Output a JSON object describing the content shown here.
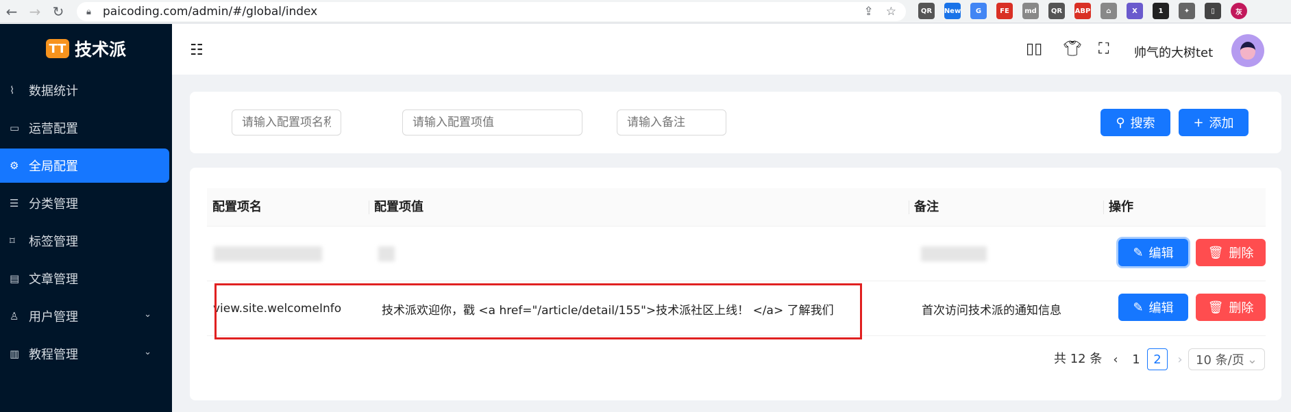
{
  "browser": {
    "url": "paicoding.com/admin/#/global/index",
    "extensions": [
      {
        "label": "QR",
        "color": "#555555"
      },
      {
        "label": "New",
        "color": "#1a73e8"
      },
      {
        "label": "G",
        "color": "#4285f4"
      },
      {
        "label": "FE",
        "color": "#d93025"
      },
      {
        "label": "md",
        "color": "#888888"
      },
      {
        "label": "QR",
        "color": "#555555"
      },
      {
        "label": "ABP",
        "color": "#d93025"
      },
      {
        "label": "⌂",
        "color": "#888888"
      },
      {
        "label": "X",
        "color": "#6a5acd"
      },
      {
        "label": "1",
        "color": "#222222"
      },
      {
        "label": "✦",
        "color": "#666666"
      },
      {
        "label": "▯",
        "color": "#444444"
      },
      {
        "label": "灰",
        "color": "#c2185b"
      }
    ]
  },
  "sidebar": {
    "logo_mark": "TT",
    "logo_text": "技术派",
    "items": [
      {
        "label": "数据统计",
        "icon": "chart-line-icon",
        "glyph": "⌇"
      },
      {
        "label": "运营配置",
        "icon": "calendar-icon",
        "glyph": "▭"
      },
      {
        "label": "全局配置",
        "icon": "gear-icon",
        "glyph": "⚙"
      },
      {
        "label": "分类管理",
        "icon": "list-icon",
        "glyph": "☰"
      },
      {
        "label": "标签管理",
        "icon": "tag-icon",
        "glyph": "⌑"
      },
      {
        "label": "文章管理",
        "icon": "document-icon",
        "glyph": "▤"
      },
      {
        "label": "用户管理",
        "icon": "user-icon",
        "glyph": "♙"
      },
      {
        "label": "教程管理",
        "icon": "book-icon",
        "glyph": "▥"
      }
    ]
  },
  "header": {
    "collapse_glyph": "☷",
    "user_name": "帅气的大树tet"
  },
  "filter": {
    "name_placeholder": "请输入配置项名称",
    "value_placeholder": "请输入配置项值",
    "remark_placeholder": "请输入备注",
    "search_label": "搜索",
    "add_label": "添加"
  },
  "table": {
    "columns": [
      "配置项名",
      "配置项值",
      "备注",
      "操作"
    ],
    "rows": [
      {
        "name": "",
        "value": "",
        "remark": "",
        "blurred": true
      },
      {
        "name": "view.site.welcomeInfo",
        "value": "技术派欢迎你，戳 <a href=\"/article/detail/155\">技术派社区上线！ </a> 了解我们",
        "remark": "首次访问技术派的通知信息",
        "blurred": false
      }
    ],
    "edit_label": "编辑",
    "delete_label": "删除"
  },
  "pagination": {
    "total_text": "共 12 条",
    "pages": [
      "1",
      "2"
    ],
    "current_page": "2",
    "page_size": "10 条/页"
  },
  "colors": {
    "primary": "#1677ff",
    "danger": "#ff4d4f",
    "sidebar": "#001529",
    "highlight_box": "#e02020"
  }
}
